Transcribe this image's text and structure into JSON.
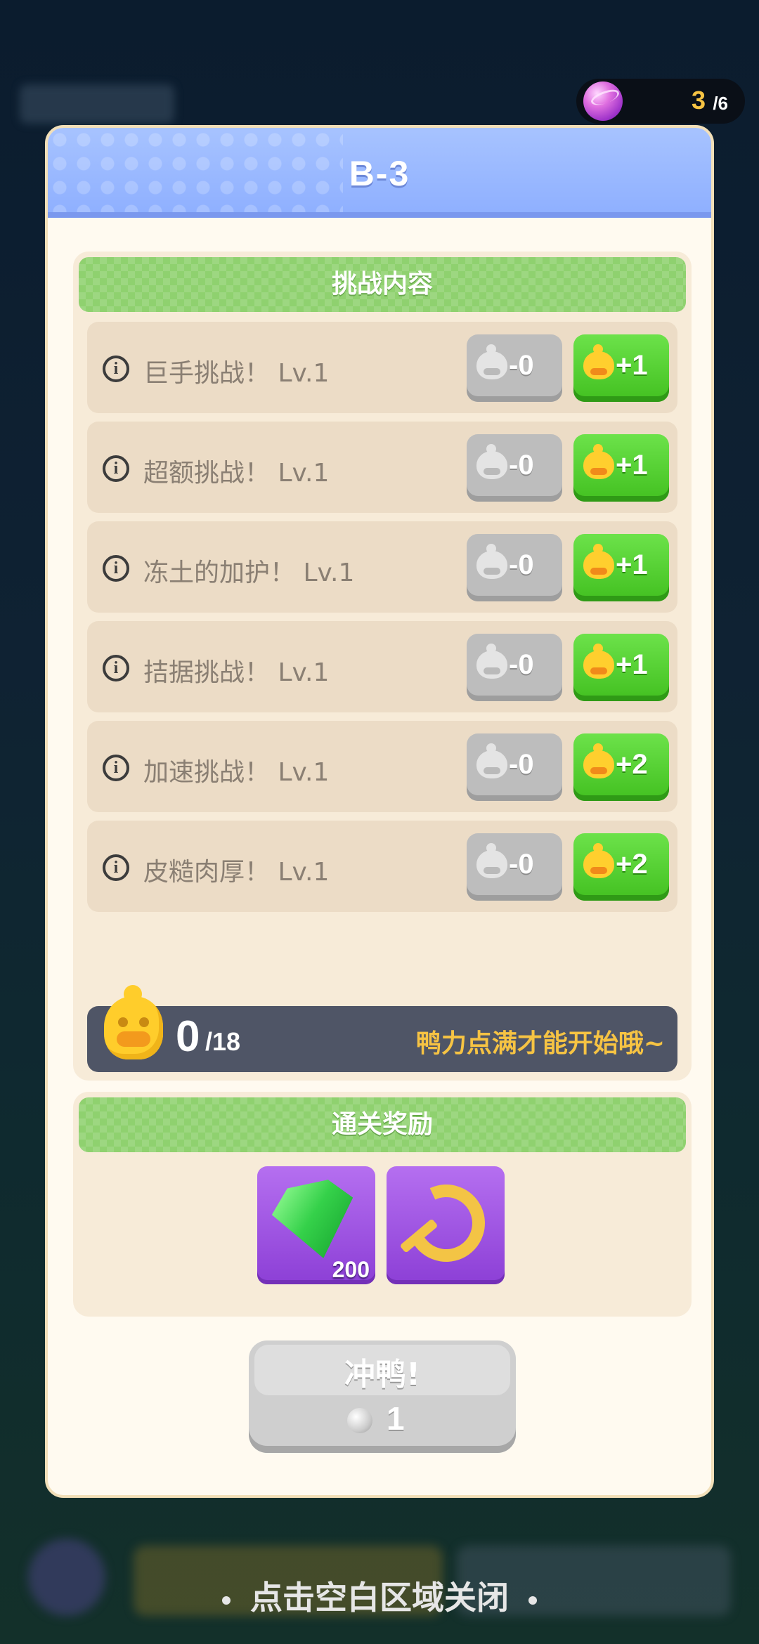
{
  "currency": {
    "icon": "purple-orb-icon",
    "count": "3",
    "total": "/6"
  },
  "modal": {
    "title": "B-3"
  },
  "challenge_panel": {
    "banner": "挑战内容",
    "rows": [
      {
        "label": "巨手挑战！ Lv.1",
        "minus": "-0",
        "plus": "+1"
      },
      {
        "label": "超额挑战！ Lv.1",
        "minus": "-0",
        "plus": "+1"
      },
      {
        "label": "冻土的加护！ Lv.1",
        "minus": "-0",
        "plus": "+1"
      },
      {
        "label": "拮据挑战！ Lv.1",
        "minus": "-0",
        "plus": "+1"
      },
      {
        "label": "加速挑战！ Lv.1",
        "minus": "-0",
        "plus": "+2"
      },
      {
        "label": "皮糙肉厚！ Lv.1",
        "minus": "-0",
        "plus": "+2"
      }
    ],
    "points": {
      "current": "0",
      "total": "/18",
      "hint": "鸭力点满才能开始哦~"
    }
  },
  "reward_panel": {
    "banner": "通关奖励",
    "rewards": [
      {
        "icon": "green-gem-icon",
        "count": "200"
      },
      {
        "icon": "golden-crescent-icon"
      }
    ]
  },
  "start_button": {
    "label": "冲鸭!",
    "cost": "1"
  },
  "close_hint": "点击空白区域关闭",
  "colors": {
    "header_blue": "#8fb0ff",
    "banner_green": "#8fd16f",
    "plus_green": "#42c020",
    "accent_yellow": "#f6c343",
    "reward_purple": "#8c3fd6"
  }
}
